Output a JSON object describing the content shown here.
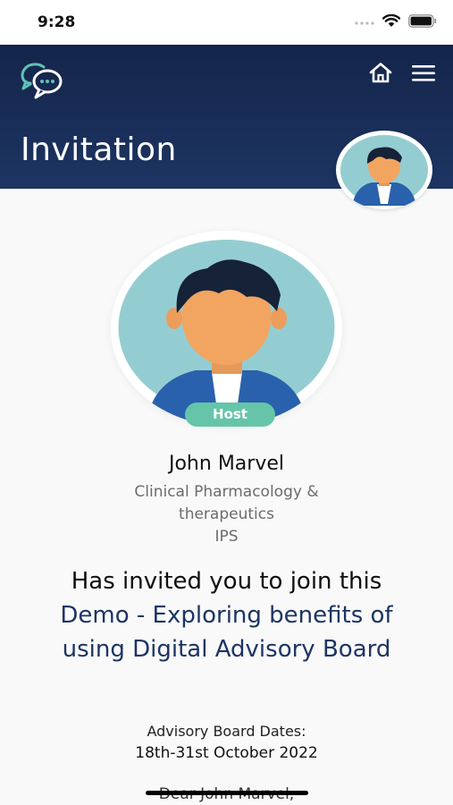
{
  "status_bar": {
    "time": "9:28"
  },
  "header": {
    "title": "Invitation",
    "logo_icon": "chat-bubbles-logo",
    "home_icon": "home-icon",
    "menu_icon": "hamburger-menu-icon",
    "background_color": "#1d3563"
  },
  "host": {
    "badge": "Host",
    "name": "John Marvel",
    "department_line1": "Clinical Pharmacology &",
    "department_line2": "therapeutics",
    "organization": "IPS",
    "badge_color": "#66c5a9"
  },
  "invitation": {
    "line1": "Has invited you to join",
    "line2_prefix": "this ",
    "event_name": "Demo - Exploring benefits of using Digital Advisory Board",
    "event_color": "#1d3563"
  },
  "dates": {
    "label": "Advisory Board Dates:",
    "value": "18th-31st October 2022"
  },
  "greeting": "Dear John Marvel,"
}
